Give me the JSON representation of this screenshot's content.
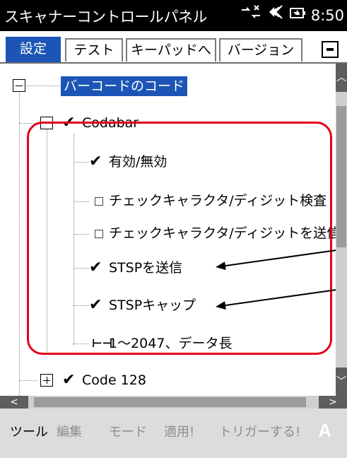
{
  "window": {
    "title": "スキャナーコントロールパネル",
    "time": "8:50",
    "status_icons": [
      "connection-icon",
      "speaker-icon",
      "battery-icon"
    ]
  },
  "tabs": [
    {
      "label": "設定",
      "active": true
    },
    {
      "label": "テスト",
      "active": false
    },
    {
      "label": "キーパッドへ",
      "active": false
    },
    {
      "label": "バージョン",
      "active": false
    }
  ],
  "tree": {
    "root": {
      "label": "バーコードのコード",
      "expanded": true,
      "selected": true
    },
    "codabar": {
      "label": "Codabar",
      "checked": true,
      "expanded": true,
      "children": [
        {
          "label": "有効/無効",
          "checked": true
        },
        {
          "label": "チェックキャラクタ/ディジット検査",
          "checked": false
        },
        {
          "label": "チェックキャラクタ/ディジットを送信",
          "checked": false
        },
        {
          "label": "STSPを送信",
          "checked": true
        },
        {
          "label": "STSPキャップ",
          "checked": true
        },
        {
          "label": "1～2047、データ長",
          "type": "range"
        }
      ]
    },
    "code128": {
      "label": "Code 128",
      "checked": true,
      "expanded": false
    }
  },
  "menu": {
    "items": [
      {
        "label": "ツール",
        "enabled": true
      },
      {
        "label": "編集",
        "enabled": false
      },
      {
        "label": "モード",
        "enabled": false
      },
      {
        "label": "適用!",
        "enabled": false
      },
      {
        "label": "トリガーする!",
        "enabled": false
      }
    ],
    "input_indicator": "A"
  },
  "colors": {
    "accent": "#1c55b5",
    "annotation": "#e2001a",
    "titlebar": "#000000",
    "menubar": "#dcdcdc"
  }
}
